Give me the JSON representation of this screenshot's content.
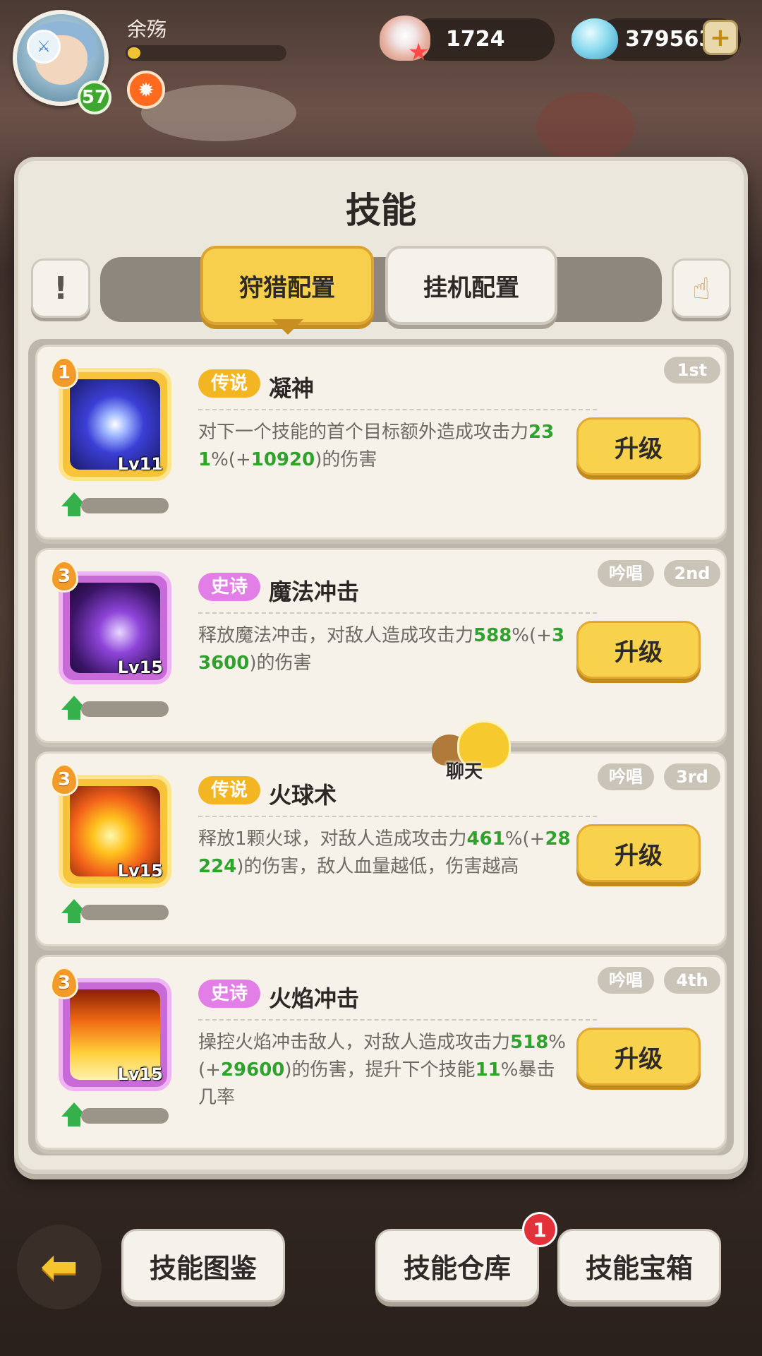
{
  "player": {
    "name": "余殇",
    "level": "57",
    "xp_fraction": 0.08,
    "status_icon": "orange-gear-badge"
  },
  "resources": {
    "pearls": "1724",
    "gems": "379563"
  },
  "panel": {
    "title": "技能",
    "tabs": [
      {
        "label": "狩猎配置",
        "active": true
      },
      {
        "label": "挂机配置",
        "active": false
      }
    ],
    "info_button": "!",
    "hand_icon": "hand-tap-icon"
  },
  "skills": [
    {
      "rarity": "传说",
      "rarity_type": "legend",
      "name": "凝神",
      "rank": "1",
      "level": "Lv11",
      "tags": [
        "1st"
      ],
      "desc": [
        {
          "t": "对下一个技能的首个目标额外造成攻击力",
          "g": false
        },
        {
          "t": "231",
          "g": true
        },
        {
          "t": "%(+",
          "g": false
        },
        {
          "t": "10920",
          "g": true
        },
        {
          "t": ")的伤害",
          "g": false
        }
      ],
      "upgrade_label": "升级",
      "progress": 0.0
    },
    {
      "rarity": "史诗",
      "rarity_type": "epic",
      "name": "魔法冲击",
      "rank": "3",
      "level": "Lv15",
      "tags": [
        "吟唱",
        "2nd"
      ],
      "desc": [
        {
          "t": "释放魔法冲击，对敌人造成攻击力",
          "g": false
        },
        {
          "t": "588",
          "g": true
        },
        {
          "t": "%(+",
          "g": false
        },
        {
          "t": "33600",
          "g": true
        },
        {
          "t": ")的伤害",
          "g": false
        }
      ],
      "upgrade_label": "升级",
      "progress": 0.0
    },
    {
      "rarity": "传说",
      "rarity_type": "legend",
      "name": "火球术",
      "rank": "3",
      "level": "Lv15",
      "tags": [
        "吟唱",
        "3rd"
      ],
      "desc": [
        {
          "t": "释放1颗火球，对敌人造成攻击力",
          "g": false
        },
        {
          "t": "461",
          "g": true
        },
        {
          "t": "%(+",
          "g": false
        },
        {
          "t": "28224",
          "g": true
        },
        {
          "t": ")的伤害，敌人血量越低，伤害越高",
          "g": false
        }
      ],
      "upgrade_label": "升级",
      "progress": 0.0
    },
    {
      "rarity": "史诗",
      "rarity_type": "epic",
      "name": "火焰冲击",
      "rank": "3",
      "level": "Lv15",
      "tags": [
        "吟唱",
        "4th"
      ],
      "desc": [
        {
          "t": "操控火焰冲击敌人，对敌人造成攻击力",
          "g": false
        },
        {
          "t": "518",
          "g": true
        },
        {
          "t": "%(+",
          "g": false
        },
        {
          "t": "29600",
          "g": true
        },
        {
          "t": ")的伤害，提升下个技能",
          "g": false
        },
        {
          "t": "11",
          "g": true
        },
        {
          "t": "%暴击几率",
          "g": false
        }
      ],
      "upgrade_label": "升级",
      "progress": 0.0
    }
  ],
  "chat": {
    "label": "聊天"
  },
  "bottom": {
    "back_icon": "back-arrow-icon",
    "buttons": [
      "技能图鉴",
      "技能仓库",
      "技能宝箱"
    ],
    "warehouse_badge": "1"
  },
  "colors": {
    "gold_button": "#f8d24c",
    "legend": "#f2b623",
    "epic": "#e27fe7",
    "green_value": "#2fa22d"
  }
}
